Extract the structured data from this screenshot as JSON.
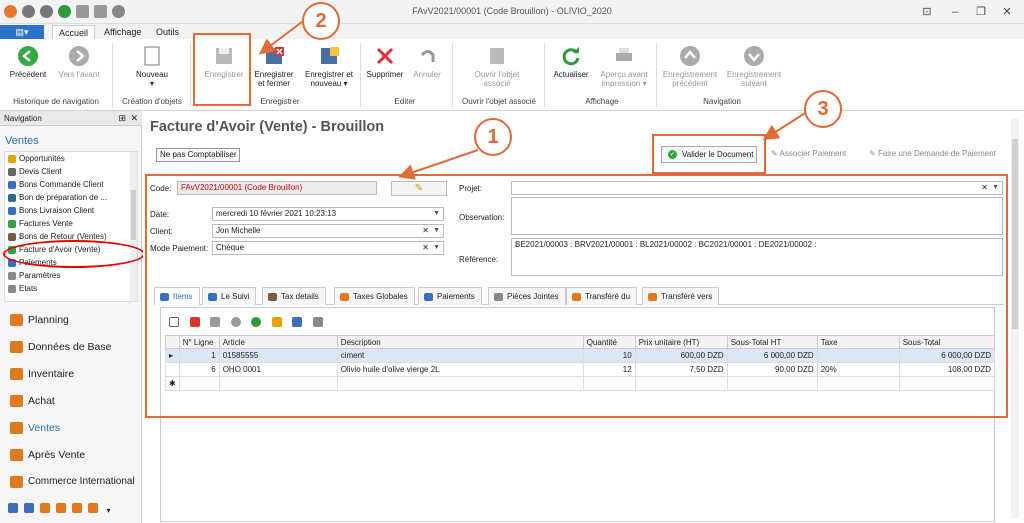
{
  "window": {
    "title": "FAvV2021/00001 (Code Brouillon) - OLIVIO_2020"
  },
  "tabs": [
    {
      "label": "Accueil"
    },
    {
      "label": "Affichage"
    },
    {
      "label": "Outils"
    }
  ],
  "ribbon": {
    "buttons": [
      {
        "label": "Précédent"
      },
      {
        "label": "Vers l'avant"
      },
      {
        "label": "Nouveau"
      },
      {
        "label": "Enregistrer"
      },
      {
        "label": "Enregistrer et fermer"
      },
      {
        "label": "Enregistrer et nouveau"
      },
      {
        "label": "Supprimer"
      },
      {
        "label": "Annuler"
      },
      {
        "label": "Ouvrir l'objet associé"
      },
      {
        "label": "Actualiser"
      },
      {
        "label": "Aperçu avant impression"
      },
      {
        "label": "Enregistrement précédent"
      },
      {
        "label": "Enregistrement suivant"
      }
    ],
    "groups": [
      {
        "label": "Historique de navigation"
      },
      {
        "label": "Création d'objets"
      },
      {
        "label": "Enregistrer"
      },
      {
        "label": "Editer"
      },
      {
        "label": "Ouvrir l'objet associé"
      },
      {
        "label": "Affichage"
      },
      {
        "label": "Navigation"
      }
    ]
  },
  "nav": {
    "header": "Navigation",
    "section": "Ventes",
    "items": [
      {
        "label": "Opportunités"
      },
      {
        "label": "Devis Client"
      },
      {
        "label": "Bons Commande Client"
      },
      {
        "label": "Bon de préparation de ..."
      },
      {
        "label": "Bons Livraison Client"
      },
      {
        "label": "Factures Vente"
      },
      {
        "label": "Bons de Retour (Ventes)"
      },
      {
        "label": "Facture d'Avoir (Vente)"
      },
      {
        "label": "Paiements"
      },
      {
        "label": "Paramètres"
      },
      {
        "label": "Etats"
      }
    ],
    "modules": [
      {
        "label": "Planning"
      },
      {
        "label": "Données de Base"
      },
      {
        "label": "Inventaire"
      },
      {
        "label": "Achat"
      },
      {
        "label": "Ventes"
      },
      {
        "label": "Après Vente"
      },
      {
        "label": "Commerce International"
      }
    ]
  },
  "doc": {
    "title": "Facture d'Avoir (Vente) - Brouillon",
    "ne_pas_comptabiliser": "Ne pas Comptabiliser",
    "valider": "Valider le Document",
    "associer": "Associer Paiement",
    "demande": "Faire une Demande de Paiement"
  },
  "form": {
    "code_label": "Code:",
    "code_value": "FAvV2021/00001 (Code Brouillon)",
    "date_label": "Date:",
    "date_value": "mercredi 10 février 2021 10:23:13",
    "client_label": "Client:",
    "client_value": "Jon Michelle",
    "mode_label": "Mode Paiement:",
    "mode_value": "Chèque",
    "projet_label": "Projet:",
    "projet_value": "",
    "observation_label": "Observation:",
    "observation_value": "",
    "reference_label": "Référence:",
    "reference_value": "BE2021/00003 : BRV2021/00001 : BL2021/00002 : BC2021/00001 : DE2021/00002 :"
  },
  "subtabs": [
    {
      "label": "Items"
    },
    {
      "label": "Le Suivi"
    },
    {
      "label": "Tax details"
    },
    {
      "label": "Taxes Globales"
    },
    {
      "label": "Paiements"
    },
    {
      "label": "Pièces Jointes"
    },
    {
      "label": "Transféré du"
    },
    {
      "label": "Transféré vers"
    }
  ],
  "grid": {
    "columns": [
      "N° Ligne",
      "Article",
      "Description",
      "Quantité",
      "Prix unitaire (HT)",
      "Sous-Total HT",
      "Taxe",
      "Sous-Total"
    ],
    "rows": [
      {
        "ligne": "1",
        "article": "01585555",
        "description": "ciment",
        "quantite": "10",
        "prix": "600,00 DZD",
        "sous_total_ht": "6 000,00 DZD",
        "taxe": "",
        "sous_total": "6 000,00 DZD"
      },
      {
        "ligne": "6",
        "article": "OHO 0001",
        "description": "Olivio huile d'olive vierge 2L",
        "quantite": "12",
        "prix": "7,50 DZD",
        "sous_total_ht": "90,00 DZD",
        "taxe": "20%",
        "sous_total": "108,00 DZD"
      }
    ]
  },
  "callouts": [
    {
      "label": "1"
    },
    {
      "label": "2"
    },
    {
      "label": "3"
    }
  ]
}
